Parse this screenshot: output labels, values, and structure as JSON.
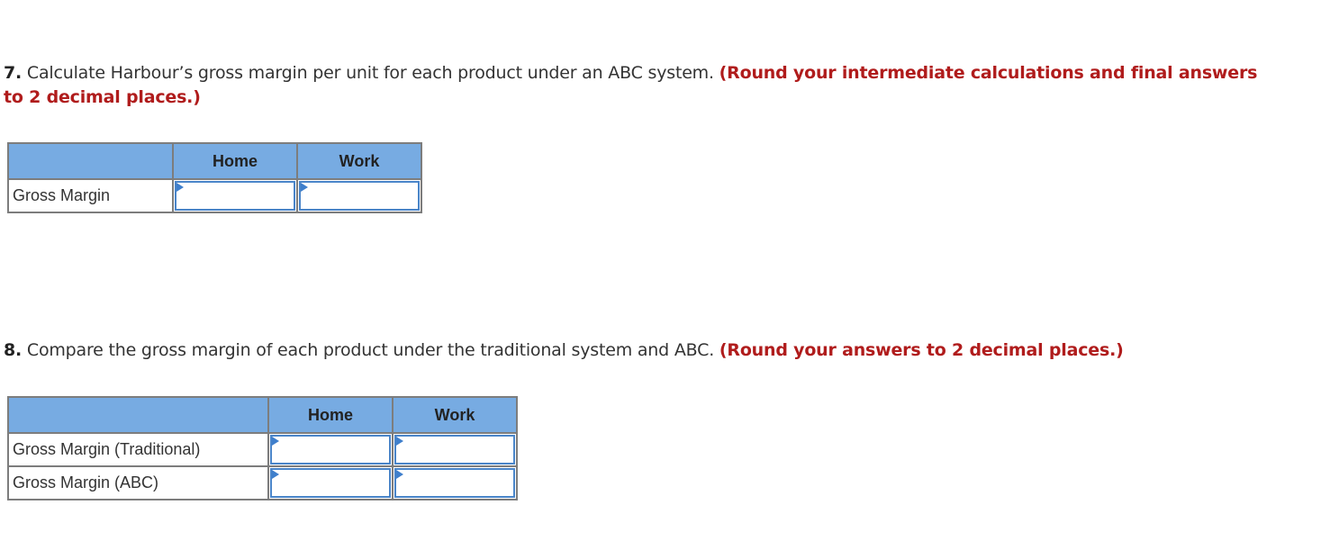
{
  "question7": {
    "number": "7.",
    "text": " Calculate Harbour’s gross margin per unit for each product under an ABC system. ",
    "instruction": "(Round your intermediate calculations and final answers to 2 decimal places.)",
    "table": {
      "columns": [
        "",
        "Home",
        "Work"
      ],
      "rows": [
        {
          "label": "Gross Margin",
          "values": [
            "",
            ""
          ]
        }
      ]
    }
  },
  "question8": {
    "number": "8.",
    "text": " Compare the gross margin of each product under the traditional system and ABC. ",
    "instruction": "(Round your answers to 2 decimal places.)",
    "table": {
      "columns": [
        "",
        "Home",
        "Work"
      ],
      "rows": [
        {
          "label": "Gross Margin (Traditional)",
          "values": [
            "",
            ""
          ]
        },
        {
          "label": "Gross Margin (ABC)",
          "values": [
            "",
            ""
          ]
        }
      ]
    }
  },
  "colors": {
    "header_bg": "#77abe2",
    "instruction_red": "#b01c1c",
    "input_border": "#4a85c9",
    "grid_border": "#7d7d7d"
  }
}
